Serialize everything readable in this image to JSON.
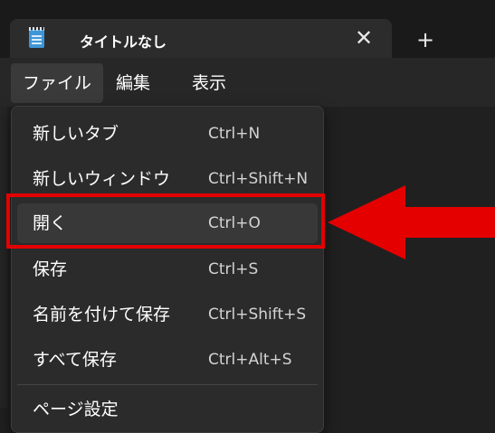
{
  "tab": {
    "title": "タイトルなし",
    "icon": "notepad-icon",
    "close_glyph": "✕",
    "add_glyph": "+"
  },
  "menubar": {
    "items": [
      "ファイル",
      "編集",
      "表示"
    ]
  },
  "file_menu": {
    "items": [
      {
        "label": "新しいタブ",
        "shortcut": "Ctrl+N"
      },
      {
        "label": "新しいウィンドウ",
        "shortcut": "Ctrl+Shift+N"
      },
      {
        "label": "開く",
        "shortcut": "Ctrl+O",
        "highlighted": true
      },
      {
        "label": "保存",
        "shortcut": "Ctrl+S"
      },
      {
        "label": "名前を付けて保存",
        "shortcut": "Ctrl+Shift+S"
      },
      {
        "label": "すべて保存",
        "shortcut": "Ctrl+Alt+S"
      },
      {
        "label": "ページ設定",
        "shortcut": ""
      }
    ]
  },
  "annotation": {
    "color": "#e50000",
    "target": "開く"
  },
  "colors": {
    "background": "#202020",
    "menu_background": "#2b2b2b",
    "accent_red": "#e50000"
  }
}
